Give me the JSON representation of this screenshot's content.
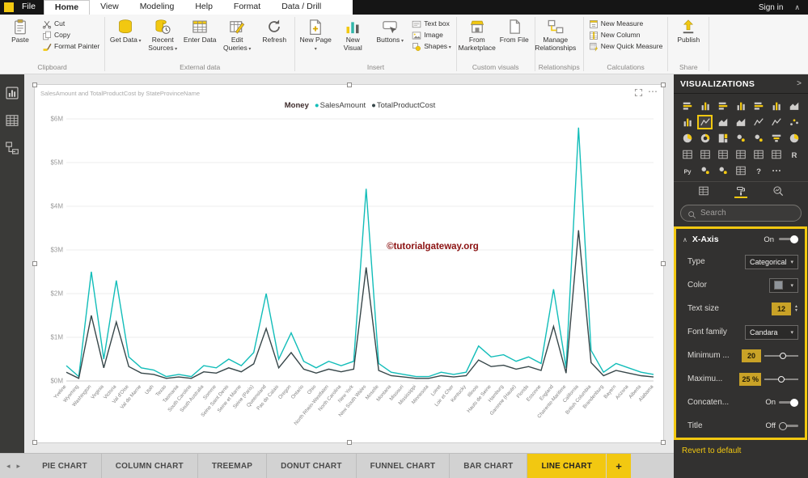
{
  "titlebar": {
    "file_label": "File",
    "menu_tabs": [
      "Home",
      "View",
      "Modeling",
      "Help",
      "Format",
      "Data / Drill"
    ],
    "active_tab": "Home",
    "sign_in": "Sign in",
    "collapse_icon": "∧"
  },
  "ribbon": {
    "groups": [
      {
        "label": "Clipboard",
        "items": [
          {
            "label": "Paste",
            "icon": "clipboard",
            "size": "lg"
          },
          {
            "label": "Cut",
            "icon": "scissors",
            "size": "sm"
          },
          {
            "label": "Copy",
            "icon": "copy",
            "size": "sm"
          },
          {
            "label": "Format Painter",
            "icon": "brush",
            "size": "sm"
          }
        ]
      },
      {
        "label": "External data",
        "items": [
          {
            "label": "Get Data",
            "icon": "db",
            "size": "lg",
            "caret": true
          },
          {
            "label": "Recent Sources",
            "icon": "db-clock",
            "size": "lg",
            "caret": true
          },
          {
            "label": "Enter Data",
            "icon": "table",
            "size": "lg"
          },
          {
            "label": "Edit Queries",
            "icon": "table-edit",
            "size": "lg",
            "caret": true
          },
          {
            "label": "Refresh",
            "icon": "refresh",
            "size": "lg"
          }
        ]
      },
      {
        "label": "Insert",
        "items": [
          {
            "label": "New Page",
            "icon": "page-plus",
            "size": "lg",
            "caret": true
          },
          {
            "label": "New Visual",
            "icon": "chart-new",
            "size": "lg"
          },
          {
            "label": "Buttons",
            "icon": "buttons",
            "size": "lg",
            "caret": true
          },
          {
            "label": "Text box",
            "icon": "textbox",
            "size": "sm"
          },
          {
            "label": "Image",
            "icon": "image",
            "size": "sm"
          },
          {
            "label": "Shapes",
            "icon": "shapes",
            "size": "sm",
            "caret": true
          }
        ]
      },
      {
        "label": "Custom visuals",
        "items": [
          {
            "label": "From Marketplace",
            "icon": "store",
            "size": "lg"
          },
          {
            "label": "From File",
            "icon": "file",
            "size": "lg"
          }
        ]
      },
      {
        "label": "Relationships",
        "items": [
          {
            "label": "Manage Relationships",
            "icon": "relationships",
            "size": "lg"
          }
        ]
      },
      {
        "label": "Calculations",
        "items": [
          {
            "label": "New Measure",
            "icon": "measure",
            "size": "sm"
          },
          {
            "label": "New Column",
            "icon": "column",
            "size": "sm"
          },
          {
            "label": "New Quick Measure",
            "icon": "quick-measure",
            "size": "sm"
          }
        ]
      },
      {
        "label": "Share",
        "items": [
          {
            "label": "Publish",
            "icon": "publish",
            "size": "lg"
          }
        ]
      }
    ]
  },
  "sidebar": {
    "items": [
      {
        "name": "report-view"
      },
      {
        "name": "data-view"
      },
      {
        "name": "model-view"
      }
    ]
  },
  "canvas": {
    "watermark": "©tutorialgateway.org",
    "more_options": "⋯"
  },
  "chart_data": {
    "type": "line",
    "title": "SalesAmount and TotalProductCost by StateProvinceName",
    "legend_title": "Money",
    "legend_position": "top",
    "grid": true,
    "ylim": [
      0,
      6
    ],
    "ytick_labels": [
      "$0M",
      "$1M",
      "$2M",
      "$3M",
      "$4M",
      "$5M",
      "$6M"
    ],
    "categories": [
      "Yveline",
      "Wyoming",
      "Washington",
      "Virginia",
      "Victoria",
      "Val d'Oise",
      "Val de Marne",
      "Utah",
      "Texas",
      "Tasmania",
      "South Carolina",
      "South Australia",
      "Somme",
      "Seine Saint Denis",
      "Seine et Marne",
      "Seine (Paris)",
      "Queensland",
      "Pas de Calais",
      "Oregon",
      "Ontario",
      "Ohio",
      "North Rhein-Westfalen",
      "North Carolina",
      "New York",
      "New South Wales",
      "Moselle",
      "Montana",
      "Missouri",
      "Mississippi",
      "Minnesota",
      "Loiret",
      "Loir et Cher",
      "Kentucky",
      "Illinois",
      "Hauts de Seine",
      "Hamburg",
      "Garonne (Haute)",
      "Florida",
      "Essonne",
      "England",
      "Charente-Maritime",
      "California",
      "British Columbia",
      "Brandenburg",
      "Bayern",
      "Arizona",
      "Alberta",
      "Alabama"
    ],
    "series": [
      {
        "name": "SalesAmount",
        "color": "#12bdb9",
        "values": [
          0.35,
          0.1,
          2.5,
          0.5,
          2.3,
          0.55,
          0.3,
          0.25,
          0.1,
          0.15,
          0.1,
          0.35,
          0.3,
          0.5,
          0.35,
          0.65,
          2.0,
          0.5,
          1.1,
          0.45,
          0.3,
          0.45,
          0.35,
          0.45,
          4.4,
          0.4,
          0.2,
          0.15,
          0.1,
          0.1,
          0.2,
          0.15,
          0.2,
          0.8,
          0.55,
          0.6,
          0.45,
          0.55,
          0.4,
          2.1,
          0.3,
          5.8,
          0.7,
          0.2,
          0.4,
          0.3,
          0.2,
          0.15
        ]
      },
      {
        "name": "TotalProductCost",
        "color": "#374649",
        "values": [
          0.2,
          0.06,
          1.5,
          0.3,
          1.35,
          0.33,
          0.18,
          0.15,
          0.06,
          0.09,
          0.06,
          0.21,
          0.18,
          0.3,
          0.21,
          0.39,
          1.2,
          0.3,
          0.65,
          0.27,
          0.18,
          0.27,
          0.21,
          0.27,
          2.6,
          0.24,
          0.12,
          0.09,
          0.06,
          0.06,
          0.12,
          0.09,
          0.12,
          0.48,
          0.33,
          0.36,
          0.27,
          0.33,
          0.24,
          1.25,
          0.18,
          3.45,
          0.42,
          0.12,
          0.24,
          0.18,
          0.12,
          0.09
        ]
      }
    ]
  },
  "visualizations_panel": {
    "title": "VISUALIZATIONS",
    "expand_icon": ">",
    "visual_icons": [
      "stacked-bar",
      "stacked-column",
      "clustered-bar",
      "clustered-column",
      "100-stacked-bar",
      "100-stacked-column",
      "ribbon-chart",
      "waterfall",
      "line",
      "area",
      "stacked-area",
      "line-stacked-column",
      "line-clustered-column",
      "scatter",
      "pie",
      "donut",
      "treemap",
      "map",
      "filled-map",
      "funnel",
      "gauge",
      "card",
      "multi-row-card",
      "kpi",
      "slicer",
      "table",
      "matrix",
      "r-script",
      "python",
      "shape-map",
      "arcgis-map",
      "paginated",
      "qa",
      "more-options"
    ],
    "selected_visual": "line",
    "pane_tabs": [
      {
        "name": "fields"
      },
      {
        "name": "format",
        "selected": true
      },
      {
        "name": "analytics"
      }
    ],
    "search_placeholder": "Search",
    "format_section": {
      "header": {
        "label": "X-Axis",
        "state": "On"
      },
      "rows": [
        {
          "label": "Type",
          "control": "dropdown",
          "value": "Categorical"
        },
        {
          "label": "Color",
          "control": "color",
          "value": ""
        },
        {
          "label": "Text size",
          "control": "stepper",
          "value": "12"
        },
        {
          "label": "Font family",
          "control": "dropdown",
          "value": "Candara"
        },
        {
          "label": "Minimum ...",
          "control": "slider",
          "value": "20"
        },
        {
          "label": "Maximu...",
          "control": "slider",
          "value": "25 %"
        },
        {
          "label": "Concaten...",
          "control": "toggle",
          "value": "On"
        },
        {
          "label": "Title",
          "control": "toggle",
          "value": "Off"
        }
      ]
    },
    "revert_label": "Revert to default"
  },
  "page_tabs": {
    "tabs": [
      "PIE CHART",
      "COLUMN CHART",
      "TREEMAP",
      "DONUT CHART",
      "FUNNEL CHART",
      "BAR CHART",
      "LINE CHART"
    ],
    "active": "LINE CHART",
    "add_label": "+"
  }
}
